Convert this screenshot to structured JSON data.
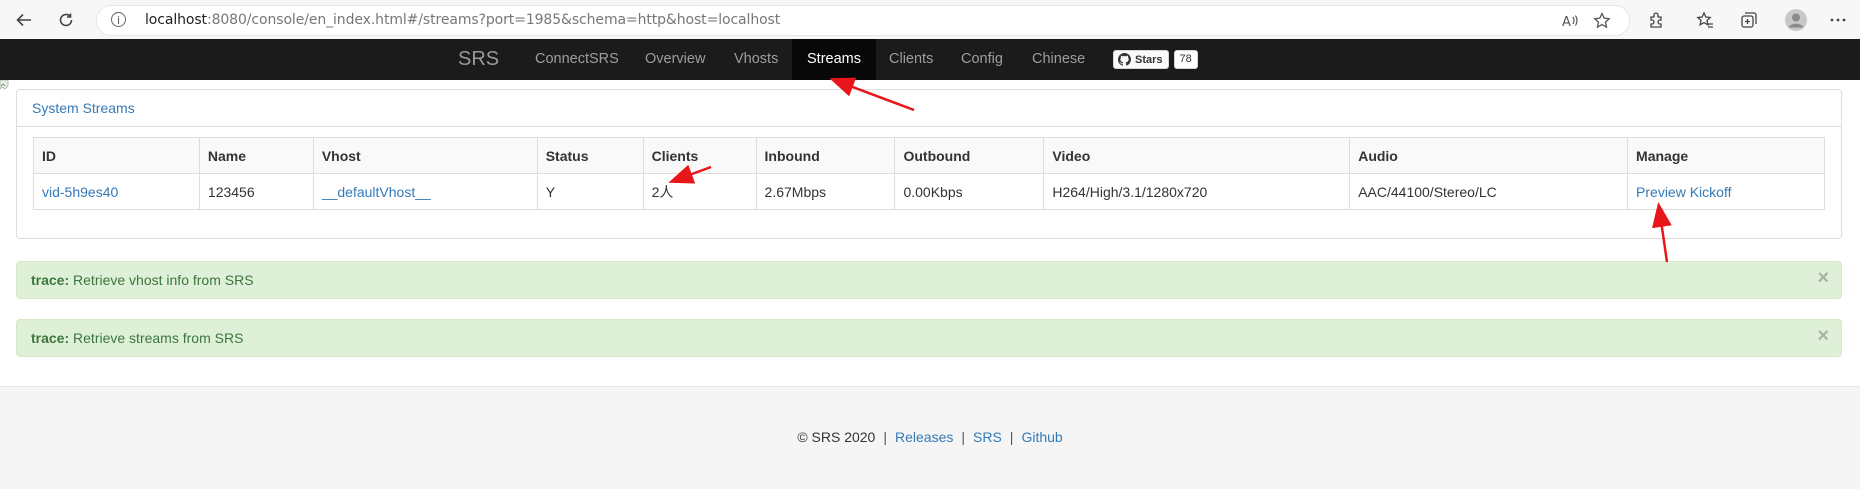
{
  "browser": {
    "url_host": "localhost",
    "url_rest": ":8080/console/en_index.html#/streams?port=1985&schema=http&host=localhost"
  },
  "navbar": {
    "brand": "SRS",
    "items": [
      {
        "label": "ConnectSRS",
        "active": false
      },
      {
        "label": "Overview",
        "active": false
      },
      {
        "label": "Vhosts",
        "active": false
      },
      {
        "label": "Streams",
        "active": true
      },
      {
        "label": "Clients",
        "active": false
      },
      {
        "label": "Config",
        "active": false
      },
      {
        "label": "Chinese",
        "active": false
      }
    ],
    "github": {
      "label": "Stars",
      "count": "78"
    }
  },
  "panel": {
    "title": "System Streams",
    "columns": [
      "ID",
      "Name",
      "Vhost",
      "Status",
      "Clients",
      "Inbound",
      "Outbound",
      "Video",
      "Audio",
      "Manage"
    ],
    "rows": [
      {
        "id": "vid-5h9es40",
        "name": "123456",
        "vhost": "__defaultVhost__",
        "status": "Y",
        "clients": "2人",
        "inbound": "2.67Mbps",
        "outbound": "0.00Kbps",
        "video": "H264/High/3.1/1280x720",
        "audio": "AAC/44100/Stereo/LC",
        "preview": "Preview",
        "kickoff": "Kickoff"
      }
    ]
  },
  "alerts": [
    {
      "level": "trace:",
      "message": "Retrieve vhost info from SRS",
      "close": "×"
    },
    {
      "level": "trace:",
      "message": "Retrieve streams from SRS",
      "close": "×"
    }
  ],
  "footer": {
    "copyright": "© SRS 2020",
    "sep": "|",
    "links": [
      "Releases",
      "SRS",
      "Github"
    ]
  },
  "colors": {
    "navbar_bg": "#1b1b1b",
    "link": "#337ab7",
    "alert_bg": "#dff0d8",
    "annotation_arrow": "#e8161b"
  }
}
